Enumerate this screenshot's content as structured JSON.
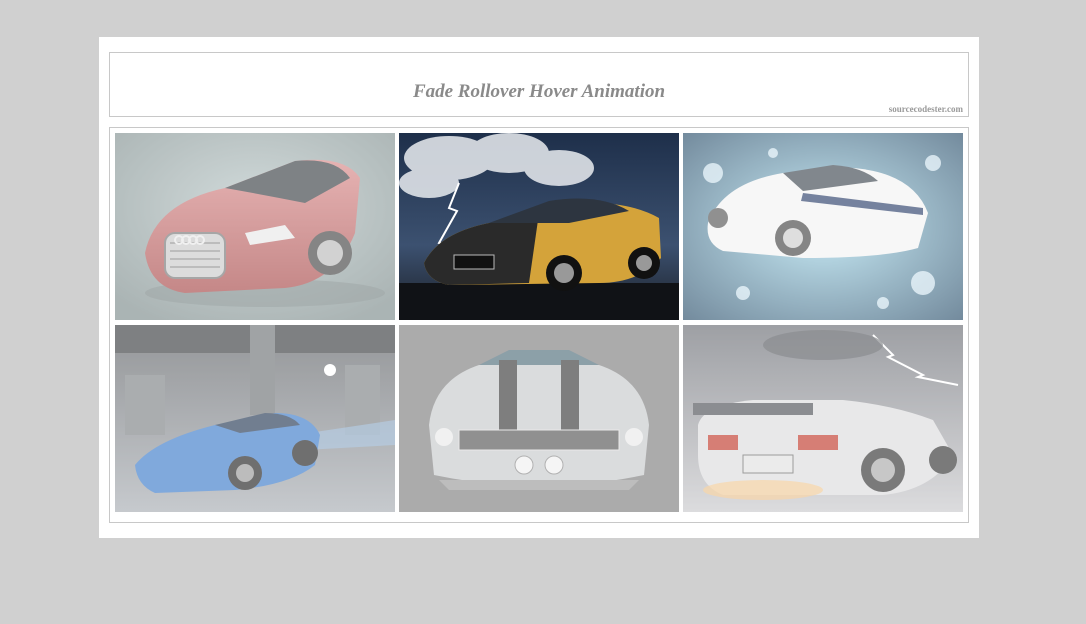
{
  "header": {
    "title": "Fade Rollover Hover Animation",
    "credit": "sourcecodester.com"
  },
  "gallery": {
    "images": [
      {
        "subject": "red concept car",
        "state": "faded"
      },
      {
        "subject": "black and gold racing car under lightning",
        "state": "active"
      },
      {
        "subject": "white muscle car with blue splash",
        "state": "faded"
      },
      {
        "subject": "blue sports car under bridge",
        "state": "faded"
      },
      {
        "subject": "classic muscle car front",
        "state": "faded"
      },
      {
        "subject": "silver supercar with lightning",
        "state": "faded"
      }
    ]
  },
  "colors": {
    "page_bg": "#d0d0d0",
    "panel_bg": "#ffffff",
    "border": "#c8c8c8",
    "title": "#8a8a8a"
  }
}
